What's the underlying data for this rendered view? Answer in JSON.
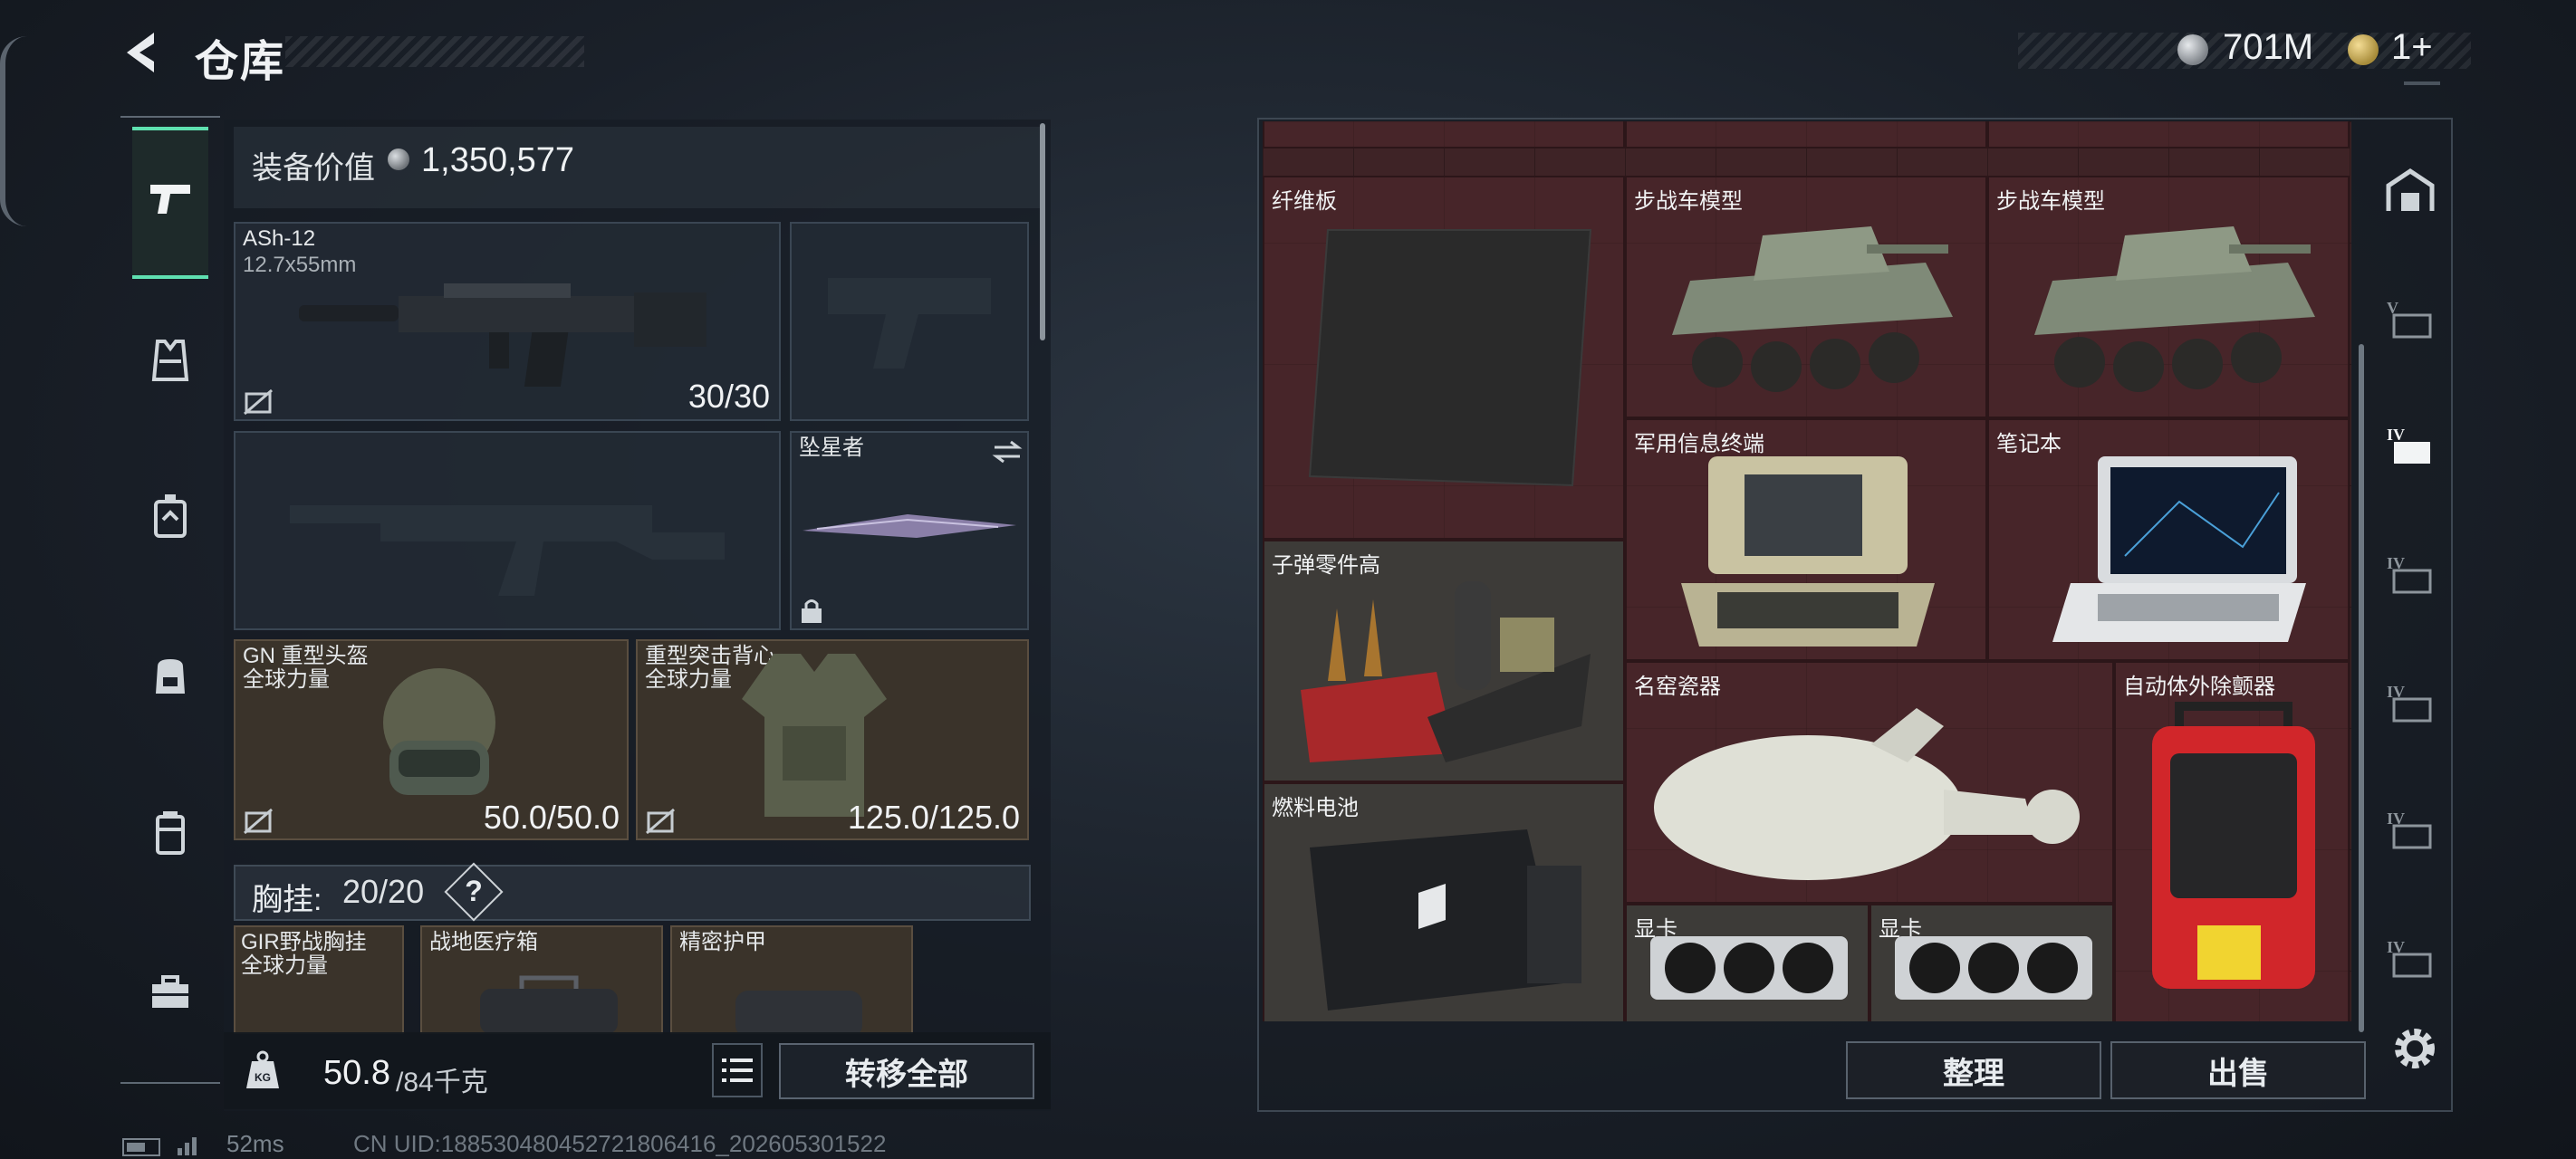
{
  "header": {
    "title": "仓库",
    "money": "701M",
    "tickets": "1+"
  },
  "categories": [
    "pistol-icon",
    "armor-vest-icon",
    "chest-rig-icon",
    "backpack-icon",
    "container-icon",
    "toolbox-icon"
  ],
  "loadout": {
    "value_label": "装备价值",
    "value_amount": "1,350,577",
    "primary": {
      "name": "ASh-12",
      "caliber": "12.7x55mm",
      "ammo": "30/30"
    },
    "melee": {
      "name": "坠星者"
    },
    "helmet": {
      "name": "GN 重型头盔",
      "brand": "全球力量",
      "durability": "50.0/50.0"
    },
    "armor": {
      "name": "重型突击背心",
      "brand": "全球力量",
      "durability": "125.0/125.0"
    },
    "chest_rig_label": "胸挂:",
    "chest_rig_value": "20/20",
    "chest_rig_help": "?",
    "bottom_slots": [
      {
        "name": "GIR野战胸挂",
        "brand": "全球力量"
      },
      {
        "name": "战地医疗箱"
      },
      {
        "name": "精密护甲"
      }
    ],
    "weight": "50.8",
    "weight_max": "/84千克",
    "transfer_all": "转移全部"
  },
  "storage": {
    "items": [
      {
        "name": "纤维板"
      },
      {
        "name": "步战车模型"
      },
      {
        "name": "步战车模型"
      },
      {
        "name": "军用信息终端"
      },
      {
        "name": "笔记本"
      },
      {
        "name": "子弹零件高"
      },
      {
        "name": "名窑瓷器"
      },
      {
        "name": "自动体外除颤器"
      },
      {
        "name": "燃料电池"
      },
      {
        "name": "显卡"
      },
      {
        "name": "显卡"
      }
    ],
    "tidy": "整理",
    "sell": "出售"
  },
  "status": {
    "ping": "52ms",
    "uid": "CN UID:18853048045272180​6416_202605301522"
  }
}
